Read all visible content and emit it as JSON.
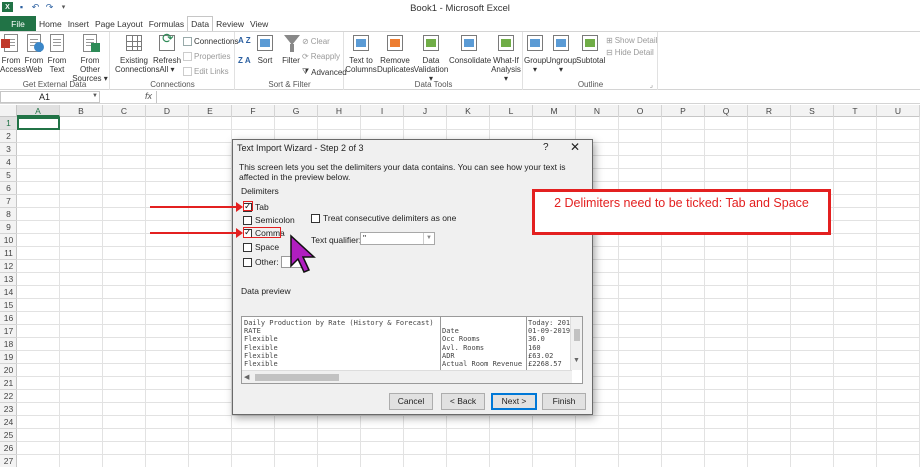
{
  "window": {
    "title": "Book1 - Microsoft Excel"
  },
  "tabs": [
    "File",
    "Home",
    "Insert",
    "Page Layout",
    "Formulas",
    "Data",
    "Review",
    "View"
  ],
  "active_tab": "Data",
  "ribbon": {
    "get_external_data": {
      "label": "Get External Data",
      "buttons": [
        {
          "l1": "From",
          "l2": "Access"
        },
        {
          "l1": "From",
          "l2": "Web"
        },
        {
          "l1": "From",
          "l2": "Text"
        },
        {
          "l1": "From Other",
          "l2": "Sources ▾"
        }
      ]
    },
    "connections": {
      "label": "Connections",
      "existing": {
        "l1": "Existing",
        "l2": "Connections"
      },
      "refresh": {
        "l1": "Refresh",
        "l2": "All ▾"
      },
      "small": [
        "Connections",
        "Properties",
        "Edit Links"
      ]
    },
    "sort_filter": {
      "label": "Sort & Filter",
      "sort": "Sort",
      "filter": "Filter",
      "small": [
        "Clear",
        "Reapply",
        "Advanced"
      ],
      "az": "A Z",
      "za": "Z A"
    },
    "data_tools": {
      "label": "Data Tools",
      "buttons": [
        {
          "l1": "Text to",
          "l2": "Columns"
        },
        {
          "l1": "Remove",
          "l2": "Duplicates"
        },
        {
          "l1": "Data",
          "l2": "Validation ▾"
        },
        {
          "l1": "Consolidate",
          "l2": ""
        },
        {
          "l1": "What-If",
          "l2": "Analysis ▾"
        }
      ]
    },
    "outline": {
      "label": "Outline",
      "buttons": [
        {
          "l1": "Group",
          "l2": "▾"
        },
        {
          "l1": "Ungroup",
          "l2": "▾"
        },
        {
          "l1": "Subtotal",
          "l2": ""
        }
      ],
      "small": [
        "Show Detail",
        "Hide Detail"
      ]
    }
  },
  "formula_bar": {
    "name_box": "A1",
    "fx": "fx",
    "value": ""
  },
  "columns": [
    "A",
    "B",
    "C",
    "D",
    "E",
    "F",
    "G",
    "H",
    "I",
    "J",
    "K",
    "L",
    "M",
    "N",
    "O",
    "P",
    "Q",
    "R",
    "S",
    "T",
    "U"
  ],
  "rows": [
    "1",
    "2",
    "3",
    "4",
    "5",
    "6",
    "7",
    "8",
    "9",
    "10",
    "11",
    "12",
    "13",
    "14",
    "15",
    "16",
    "17",
    "18",
    "19",
    "20",
    "21",
    "22",
    "23",
    "24",
    "25",
    "26",
    "27"
  ],
  "dialog": {
    "title": "Text Import Wizard - Step 2 of 3",
    "help": "?",
    "close": "✕",
    "description": "This screen lets you set the delimiters your data contains.  You can see how your text is affected in the preview below.",
    "delimiters_heading": "Delimiters",
    "checkboxes": [
      {
        "label": "Tab",
        "checked": true
      },
      {
        "label": "Semicolon",
        "checked": false
      },
      {
        "label": "Comma",
        "checked": true
      },
      {
        "label": "Space",
        "checked": false
      },
      {
        "label": "Other:",
        "checked": false
      }
    ],
    "consecutive": {
      "label": "Treat consecutive delimiters as one",
      "checked": false
    },
    "qualifier_label": "Text qualifier:",
    "qualifier_value": "\"",
    "preview_heading": "Data preview",
    "preview": {
      "col1": "Daily Production by Rate (History & Forecast)\nRATE\nFlexible\nFlexible\nFlexible\nFlexible",
      "col2": "\nDate\nOcc Rooms\nAvl. Rooms\nADR\nActual Room Revenue",
      "col3": "Today: 201\n01-09-2019\n36.0\n160\n£63.02\n£2268.57"
    },
    "buttons": {
      "cancel": "Cancel",
      "back": "< Back",
      "next": "Next >",
      "finish": "Finish"
    }
  },
  "annotation": {
    "note": "2 Delimiters need to be ticked: Tab and Space",
    "color": "#e32020"
  }
}
